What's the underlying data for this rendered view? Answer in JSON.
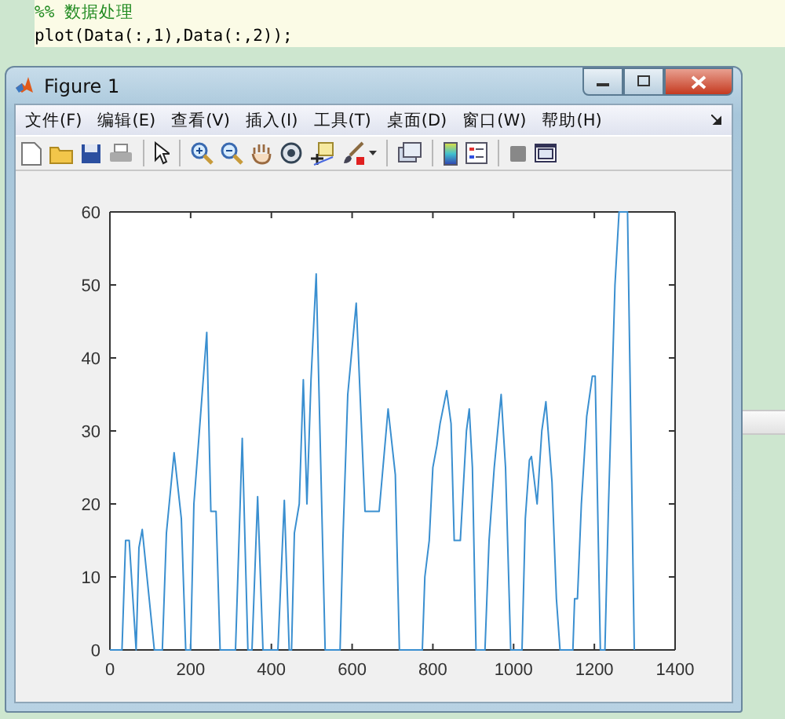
{
  "editor": {
    "lines": [
      {
        "kind": "comment",
        "text": "%% 数据处理"
      },
      {
        "kind": "code",
        "text": "plot(Data(:,1),Data(:,2));"
      }
    ]
  },
  "figure_window": {
    "title": "Figure 1",
    "menu": [
      "文件(F)",
      "编辑(E)",
      "查看(V)",
      "插入(I)",
      "工具(T)",
      "桌面(D)",
      "窗口(W)",
      "帮助(H)"
    ],
    "chart_data": {
      "type": "line",
      "xlim": [
        0,
        1400
      ],
      "ylim": [
        0,
        60
      ],
      "xticks": [
        0,
        200,
        400,
        600,
        800,
        1000,
        1200,
        1400
      ],
      "yticks": [
        0,
        10,
        20,
        30,
        40,
        50,
        60
      ],
      "x": [
        0,
        30,
        39,
        48,
        65,
        72,
        80,
        110,
        130,
        140,
        159,
        177,
        188,
        200,
        208,
        219,
        240,
        250,
        263,
        273,
        311,
        328,
        342,
        352,
        366,
        379,
        416,
        432,
        444,
        450,
        457,
        469,
        479,
        488,
        498,
        511,
        533,
        570,
        577,
        589,
        610,
        632,
        667,
        689,
        707,
        717,
        774,
        780,
        791,
        800,
        810,
        818,
        834,
        845,
        853,
        868,
        883,
        890,
        898,
        907,
        929,
        939,
        952,
        969,
        980,
        993,
        1021,
        1029,
        1039,
        1044,
        1058,
        1070,
        1080,
        1095,
        1106,
        1115,
        1147,
        1151,
        1158,
        1168,
        1181,
        1195,
        1202,
        1215,
        1226,
        1235,
        1251,
        1261,
        1282,
        1299
      ],
      "series": [
        {
          "color": "#3a8fd0",
          "values": [
            0,
            0,
            15,
            15,
            0,
            14,
            16.5,
            0,
            0,
            16,
            27,
            18,
            0,
            0,
            20,
            28,
            43.5,
            19,
            19,
            0,
            0,
            29,
            0,
            0,
            21,
            0,
            0,
            20.5,
            0,
            0,
            16,
            20,
            37,
            20,
            37,
            51.5,
            0,
            0,
            15,
            35,
            47.5,
            19,
            19,
            33,
            24,
            0,
            0,
            10,
            15,
            25,
            28,
            31,
            35.5,
            31,
            15,
            15,
            30,
            33,
            25,
            0,
            0,
            15,
            25,
            35,
            25,
            0,
            0,
            18,
            26,
            26.5,
            20,
            30,
            34,
            23,
            7,
            0,
            0,
            7,
            7,
            20,
            32,
            37.5,
            37.5,
            0,
            0,
            20,
            50,
            60,
            60,
            0
          ]
        }
      ]
    }
  }
}
